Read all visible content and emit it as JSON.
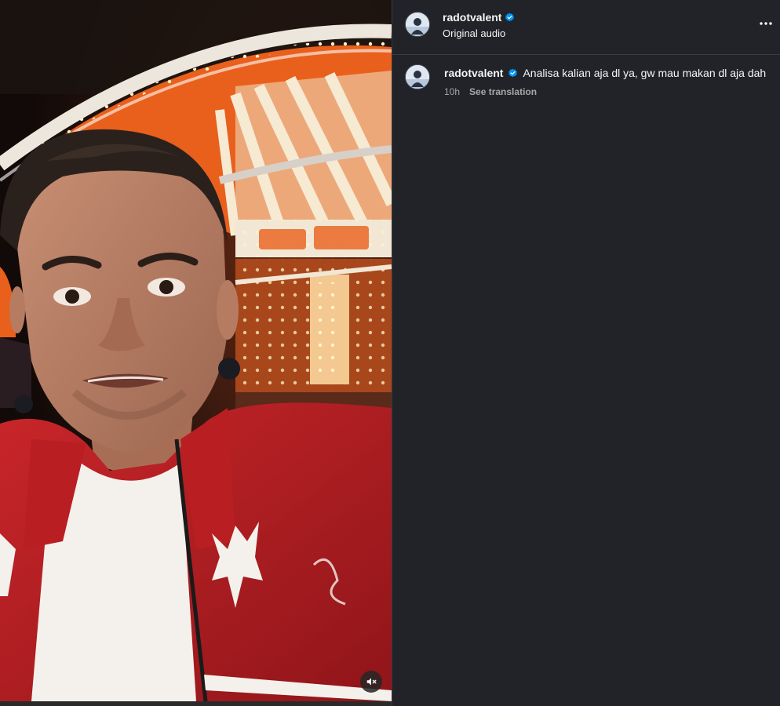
{
  "post": {
    "username": "radotvalent",
    "verified": true,
    "audio_label": "Original audio"
  },
  "caption": {
    "username": "radotvalent",
    "text": "Analisa kalian aja dl ya, gw mau makan dl aja dah",
    "timestamp": "10h",
    "translation_link": "See translation"
  },
  "icons": {
    "more": "more-horizontal-icon",
    "verified": "verified-badge-icon",
    "mute": "speaker-muted-icon"
  },
  "colors": {
    "panel_bg": "#212328",
    "verified_blue": "#0095f6",
    "jacket_red": "#d42a2a",
    "carousel_orange": "#e8601c"
  }
}
